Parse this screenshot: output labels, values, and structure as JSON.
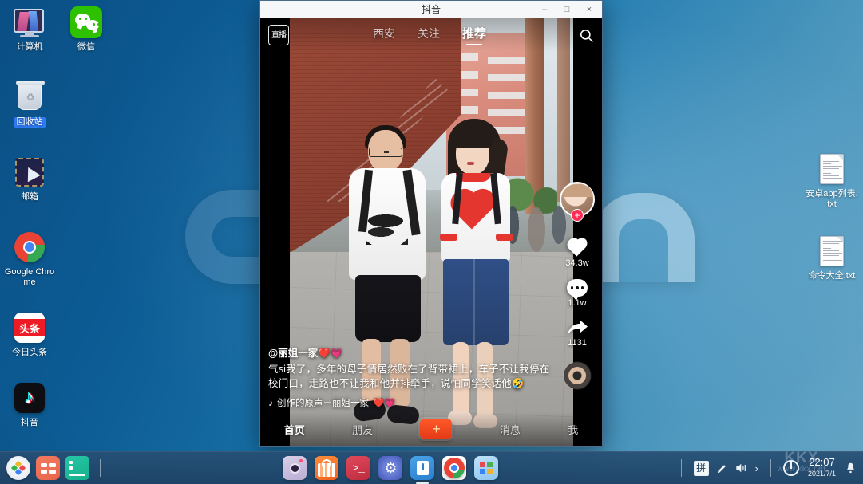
{
  "desktop": {
    "icons_left": [
      {
        "label": "计算机",
        "icon": "computer-icon",
        "selected": false
      },
      {
        "label": "回收站",
        "icon": "recycle-bin-icon",
        "selected": true
      },
      {
        "label": "邮箱",
        "icon": "mail-icon",
        "selected": false
      },
      {
        "label": "Google Chrome",
        "icon": "chrome-icon",
        "selected": false
      },
      {
        "label": "今日头条",
        "icon": "toutiao-icon",
        "selected": false
      },
      {
        "label": "抖音",
        "icon": "douyin-icon",
        "selected": false
      }
    ],
    "icons_second_column": [
      {
        "label": "微信",
        "icon": "wechat-icon",
        "selected": false
      }
    ],
    "icons_right": [
      {
        "label": "安卓app列表.txt",
        "icon": "text-file-icon",
        "selected": false
      },
      {
        "label": "命令大全.txt",
        "icon": "text-file-icon",
        "selected": false
      }
    ],
    "toutiao_glyph": "头条"
  },
  "window": {
    "title": "抖音",
    "minimize_label": "–",
    "maximize_label": "□",
    "close_label": "×"
  },
  "app": {
    "topnav": {
      "live_label": "直播",
      "tabs": [
        {
          "label": "西安",
          "active": false
        },
        {
          "label": "关注",
          "active": false
        },
        {
          "label": "推荐",
          "active": true
        }
      ],
      "search_icon": "search-icon"
    },
    "rail": {
      "avatar_name": "author-avatar",
      "follow_badge": "+",
      "like_count": "34.3w",
      "comment_count": "1.1w",
      "share_count": "1131",
      "music_disc": "music-disc"
    },
    "caption": {
      "author": "@丽姐一家",
      "author_hearts": "❤️💗",
      "text": "气si我了，多年的母子情居然败在了背带裙上，车子不让我停在校门口，走路也不让我和他并排牵手，说怕同学笑话他🤣",
      "music": "创作的原声－丽姐一家",
      "music_hearts": "❤️💗"
    },
    "bottomnav": [
      {
        "label": "首页",
        "active": true
      },
      {
        "label": "朋友",
        "active": false
      },
      {
        "label": "+",
        "active": false,
        "is_plus": true
      },
      {
        "label": "消息",
        "active": false
      },
      {
        "label": "我",
        "active": false
      }
    ]
  },
  "taskbar": {
    "left": [
      {
        "name": "start-menu-button"
      },
      {
        "name": "app-launcher-button"
      },
      {
        "name": "terminal-taskbar-button"
      }
    ],
    "center_apps": [
      {
        "name": "screenshot-app-icon",
        "running": false
      },
      {
        "name": "app-store-icon",
        "running": false
      },
      {
        "name": "terminal-icon",
        "running": false
      },
      {
        "name": "settings-icon",
        "running": false
      },
      {
        "name": "file-manager-icon",
        "running": true
      },
      {
        "name": "chrome-icon",
        "running": false
      },
      {
        "name": "windows-apps-icon",
        "running": false
      }
    ],
    "terminal_prompt": ">_",
    "tray": {
      "ime_label": "拼",
      "pen_icon": "pen-icon",
      "volume_icon": "volume-icon",
      "expand_icon": "chevron-right-icon",
      "power_icon": "power-icon",
      "time": "22:07",
      "date": "2021/7/1",
      "notification_icon": "bell-icon"
    },
    "watermark": {
      "line1": "KKX",
      "line2": "www.kkx.net"
    }
  },
  "colors": {
    "accent_red": "#fe2c55",
    "douyin_cyan": "#25f4ee",
    "wechat_green": "#2dc100",
    "taskbar_blue": "#274f75"
  }
}
